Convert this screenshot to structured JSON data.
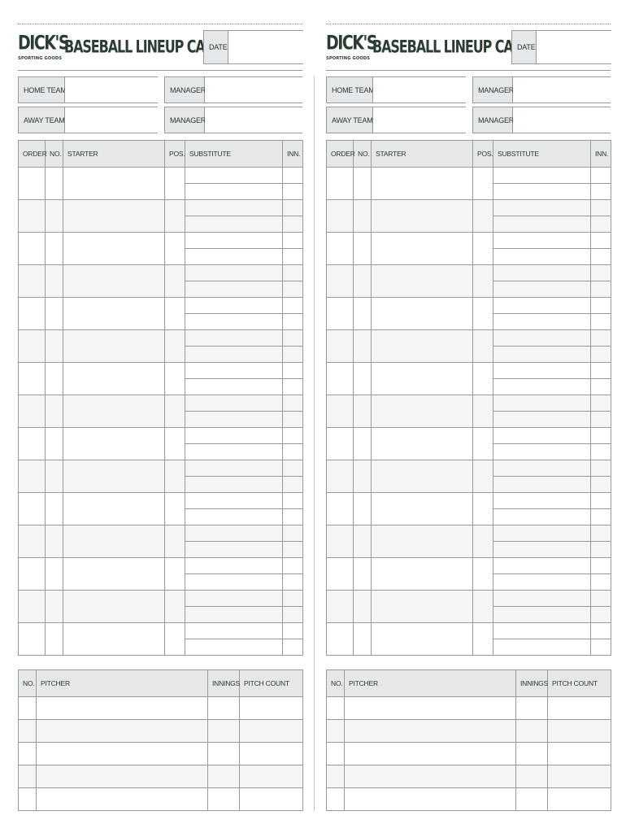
{
  "brand": {
    "name": "DICK'S",
    "tagline": "SPORTING GOODS"
  },
  "title": "BASEBALL LINEUP CARD",
  "labels": {
    "date": "DATE",
    "home_team": "HOME TEAM",
    "away_team": "AWAY TEAM",
    "manager": "MANAGER"
  },
  "lineup": {
    "columns": [
      "ORDER",
      "NO.",
      "STARTER",
      "POS.",
      "SUBSTITUTE",
      "INN."
    ],
    "row_count": 15,
    "substitutes_per_row": 2
  },
  "pitching": {
    "columns": [
      "NO.",
      "PITCHER",
      "INNINGS",
      "PITCH COUNT"
    ],
    "row_count": 5
  },
  "colors": {
    "ink": "#2c3d33",
    "header_fill": "#e6e7e8",
    "alt_row_fill": "#f4f6f5",
    "border": "#9a9a9a"
  },
  "cards": [
    {
      "id": "left",
      "date": "",
      "home_team": "",
      "home_manager": "",
      "away_team": "",
      "away_manager": ""
    },
    {
      "id": "right",
      "date": "",
      "home_team": "",
      "home_manager": "",
      "away_team": "",
      "away_manager": ""
    }
  ]
}
